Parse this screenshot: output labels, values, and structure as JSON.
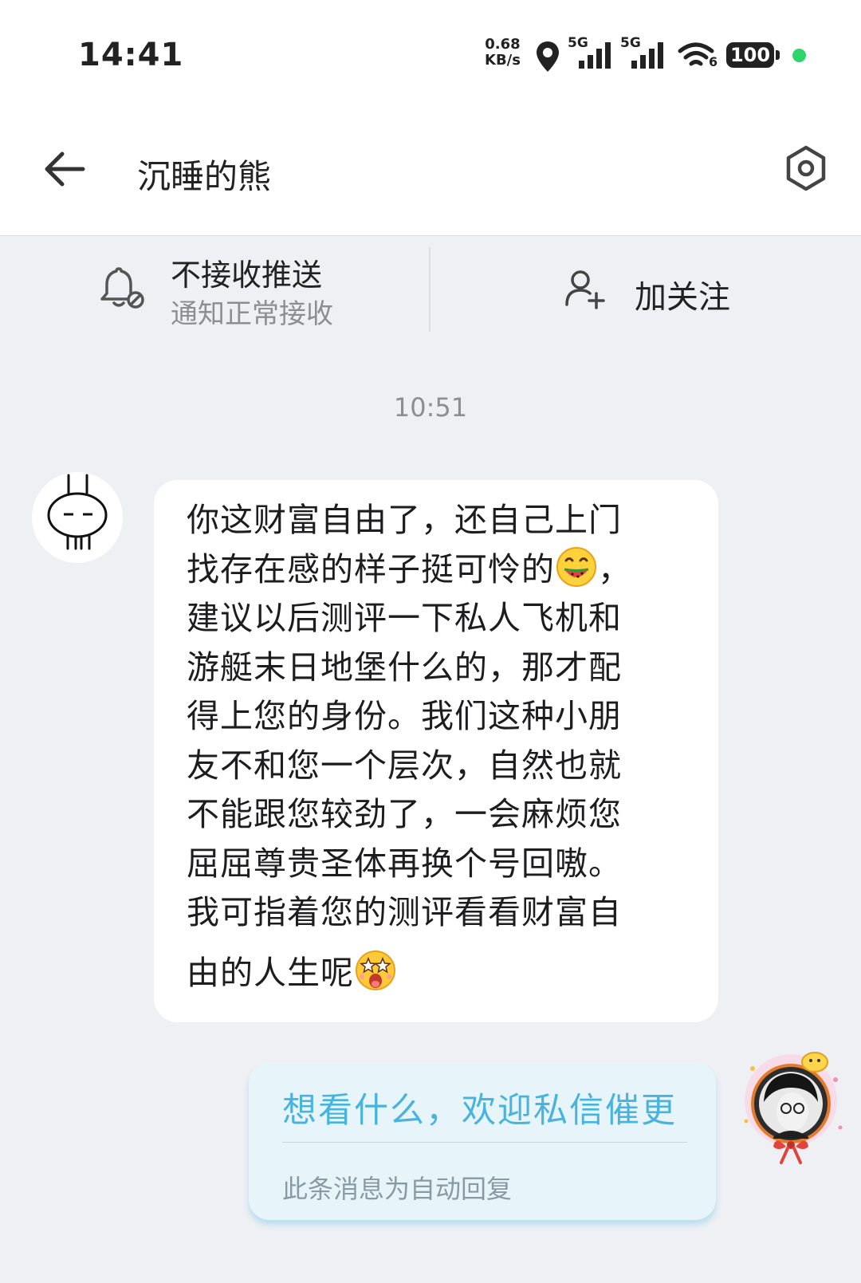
{
  "status_bar": {
    "time": "14:41",
    "net_speed_value": "0.68",
    "net_speed_unit": "KB/s",
    "sim1": "5G",
    "sim2": "5G",
    "wifi_badge": "6",
    "battery": "100",
    "icons": [
      "location-icon",
      "signal-icon",
      "signal-icon",
      "wifi-icon",
      "battery-icon",
      "status-dot"
    ]
  },
  "header": {
    "title": "沉睡的熊",
    "icons": [
      "back-arrow-icon",
      "settings-hex-icon"
    ]
  },
  "actions": {
    "push_title": "不接收推送",
    "push_subtitle": "通知正常接收",
    "follow_label": "加关注",
    "icons": [
      "bell-mute-icon",
      "add-user-icon"
    ]
  },
  "chat": {
    "timestamp": "10:51",
    "incoming": {
      "lines": [
        "你这财富自由了，还自己上门",
        "找存在感的样子挺可怜的",
        "，",
        "建议以后测评一下私人飞机和",
        "游艇末日地堡什么的，那才配",
        "得上您的身份。我们这种小朋",
        "友不和您一个层次，自然也就",
        "不能跟您较劲了，一会麻烦您",
        "屈屈尊贵圣体再换个号回嗷。",
        "我可指着您的测评看看财富自",
        "由的人生呢"
      ],
      "emojis": [
        "eating-watermelon-emoji",
        "starry-eyes-emoji"
      ]
    },
    "outgoing": {
      "text": "想看什么，欢迎私信催更",
      "note": "此条消息为自动回复"
    }
  },
  "colors": {
    "background": "#eff0f4",
    "bubble": "#ffffff",
    "reply_bubble": "#e7f5fb",
    "reply_text": "#48b4de",
    "status_dot": "#2cd46a"
  }
}
